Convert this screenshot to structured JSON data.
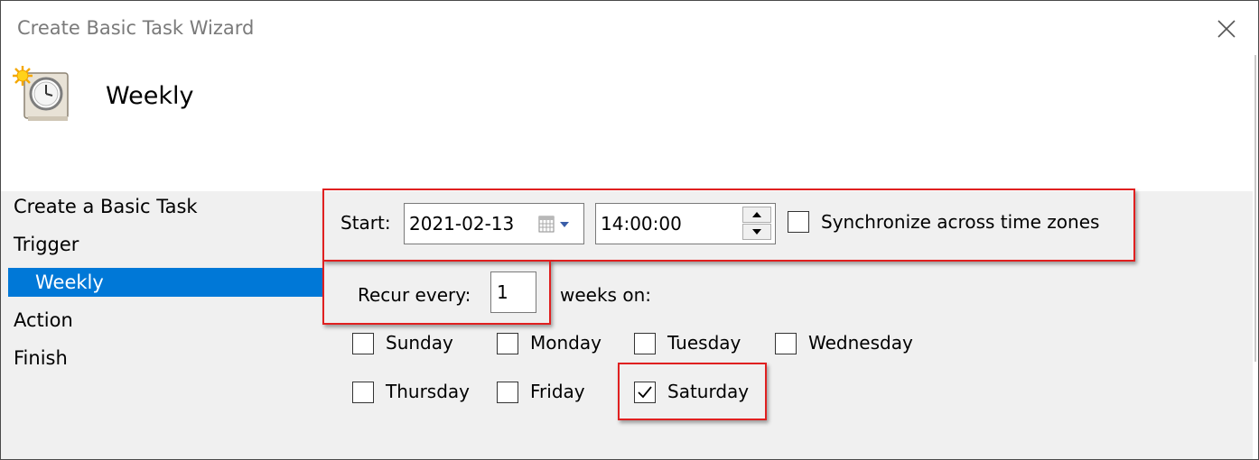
{
  "window": {
    "title": "Create Basic Task Wizard"
  },
  "header": {
    "title": "Weekly",
    "icon": "scheduled-task-clock-icon"
  },
  "steps": [
    {
      "label": "Create a Basic Task",
      "selected": false
    },
    {
      "label": "Trigger",
      "selected": false
    },
    {
      "label": "Weekly",
      "selected": true
    },
    {
      "label": "Action",
      "selected": false
    },
    {
      "label": "Finish",
      "selected": false
    }
  ],
  "trigger": {
    "start_label": "Start:",
    "start_date": "2021-02-13",
    "start_time": "14:00:00",
    "sync_label": "Synchronize across time zones",
    "sync_checked": false,
    "recur_label": "Recur every:",
    "recur_value": "1",
    "recur_suffix": "weeks on:"
  },
  "days": [
    {
      "label": "Sunday",
      "checked": false
    },
    {
      "label": "Monday",
      "checked": false
    },
    {
      "label": "Tuesday",
      "checked": false
    },
    {
      "label": "Wednesday",
      "checked": false
    },
    {
      "label": "Thursday",
      "checked": false
    },
    {
      "label": "Friday",
      "checked": false
    },
    {
      "label": "Saturday",
      "checked": true
    }
  ],
  "colors": {
    "selection": "#0078d7",
    "highlight": "#e02020",
    "panel": "#f0f0f0"
  }
}
